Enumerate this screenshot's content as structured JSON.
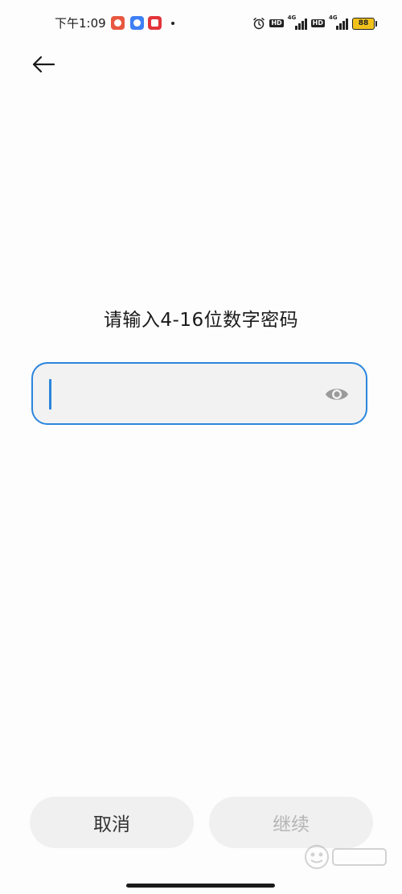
{
  "status_bar": {
    "time": "下午1:09",
    "hd_badge_1": "HD",
    "hd_badge_2": "HD",
    "signal_1_label": "4G",
    "signal_2_label": "4G",
    "battery_level": "88",
    "icons": [
      "app-notification-icon",
      "app-notification-icon",
      "app-notification-icon",
      "alarm-icon",
      "signal-icon",
      "signal-icon",
      "battery-icon"
    ]
  },
  "nav": {
    "back_icon": "arrow-left-icon"
  },
  "prompt": {
    "title": "请输入4-16位数字密码"
  },
  "password_field": {
    "value": "",
    "placeholder": "",
    "toggle_icon": "eye-icon"
  },
  "buttons": {
    "cancel_label": "取消",
    "continue_label": "继续"
  },
  "colors": {
    "accent": "#2b86dc",
    "button_bg": "#f0f0f0",
    "disabled_text": "#b5b5b5",
    "battery": "#f2c21b"
  }
}
